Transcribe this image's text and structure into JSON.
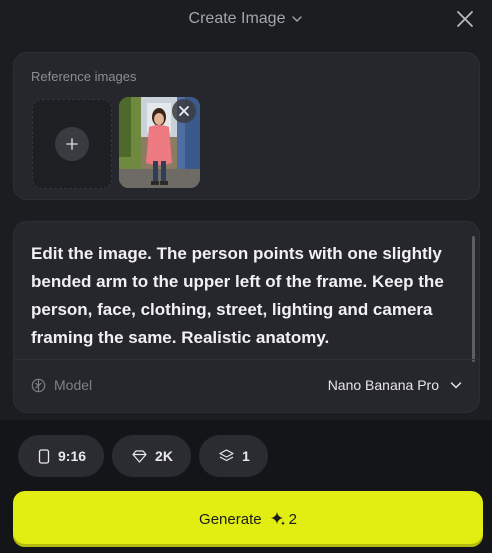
{
  "header": {
    "title": "Create Image",
    "title_icon": "chevron-down-icon",
    "close_icon": "close-icon"
  },
  "reference": {
    "label": "Reference images",
    "add_icon": "plus-icon",
    "remove_icon": "close-icon"
  },
  "prompt": {
    "text": "Edit the image. The person points with one slightly bended arm to the upper left of the frame. Keep the person, face, clothing, street, lighting and camera framing the same. Realistic anatomy."
  },
  "model": {
    "label": "Model",
    "icon": "model-icon",
    "value": "Nano Banana Pro",
    "dropdown_icon": "chevron-down-icon"
  },
  "options": {
    "aspect_ratio": "9:16",
    "aspect_icon": "phone-portrait-icon",
    "resolution": "2K",
    "resolution_icon": "diamond-icon",
    "count": "1",
    "count_icon": "layers-icon"
  },
  "generate": {
    "label": "Generate",
    "cost": "2",
    "cost_icon": "sparkle-icon",
    "accent": "#e2ed12"
  }
}
